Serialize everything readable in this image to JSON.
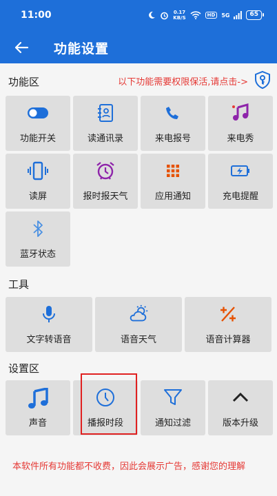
{
  "status_bar": {
    "time": "11:00",
    "speed_value": "0.17",
    "speed_unit": "KB/S",
    "hd": "HD",
    "network": "5G",
    "battery": "65"
  },
  "app_bar": {
    "title": "功能设置"
  },
  "sections": {
    "features": {
      "title": "功能区",
      "notice": "以下功能需要权限保活,请点击->",
      "items": [
        {
          "label": "功能开关",
          "icon": "toggle-icon"
        },
        {
          "label": "读通讯录",
          "icon": "contacts-icon"
        },
        {
          "label": "来电报号",
          "icon": "phone-icon"
        },
        {
          "label": "来电秀",
          "icon": "music-note-icon"
        },
        {
          "label": "读屏",
          "icon": "phone-vibrate-icon"
        },
        {
          "label": "报时报天气",
          "icon": "alarm-clock-icon"
        },
        {
          "label": "应用通知",
          "icon": "grid-icon"
        },
        {
          "label": "充电提醒",
          "icon": "battery-charge-icon"
        },
        {
          "label": "蓝牙状态",
          "icon": "bluetooth-icon"
        }
      ]
    },
    "tools": {
      "title": "工具",
      "items": [
        {
          "label": "文字转语音",
          "icon": "microphone-icon"
        },
        {
          "label": "语音天气",
          "icon": "weather-icon"
        },
        {
          "label": "语音计算器",
          "icon": "calculator-icon"
        }
      ]
    },
    "settings": {
      "title": "设置区",
      "items": [
        {
          "label": "声音",
          "icon": "music-icon"
        },
        {
          "label": "播报时段",
          "icon": "clock-icon"
        },
        {
          "label": "通知过滤",
          "icon": "filter-icon"
        },
        {
          "label": "版本升级",
          "icon": "chevron-up-icon"
        }
      ]
    }
  },
  "footer": {
    "text": "本软件所有功能都不收费，因此会展示广告，感谢您的理解"
  },
  "colors": {
    "primary": "#1e6fd9",
    "accent_red": "#e53935",
    "tile_bg": "#dedede",
    "icon_purple": "#8e24aa",
    "icon_orange": "#e65100"
  }
}
